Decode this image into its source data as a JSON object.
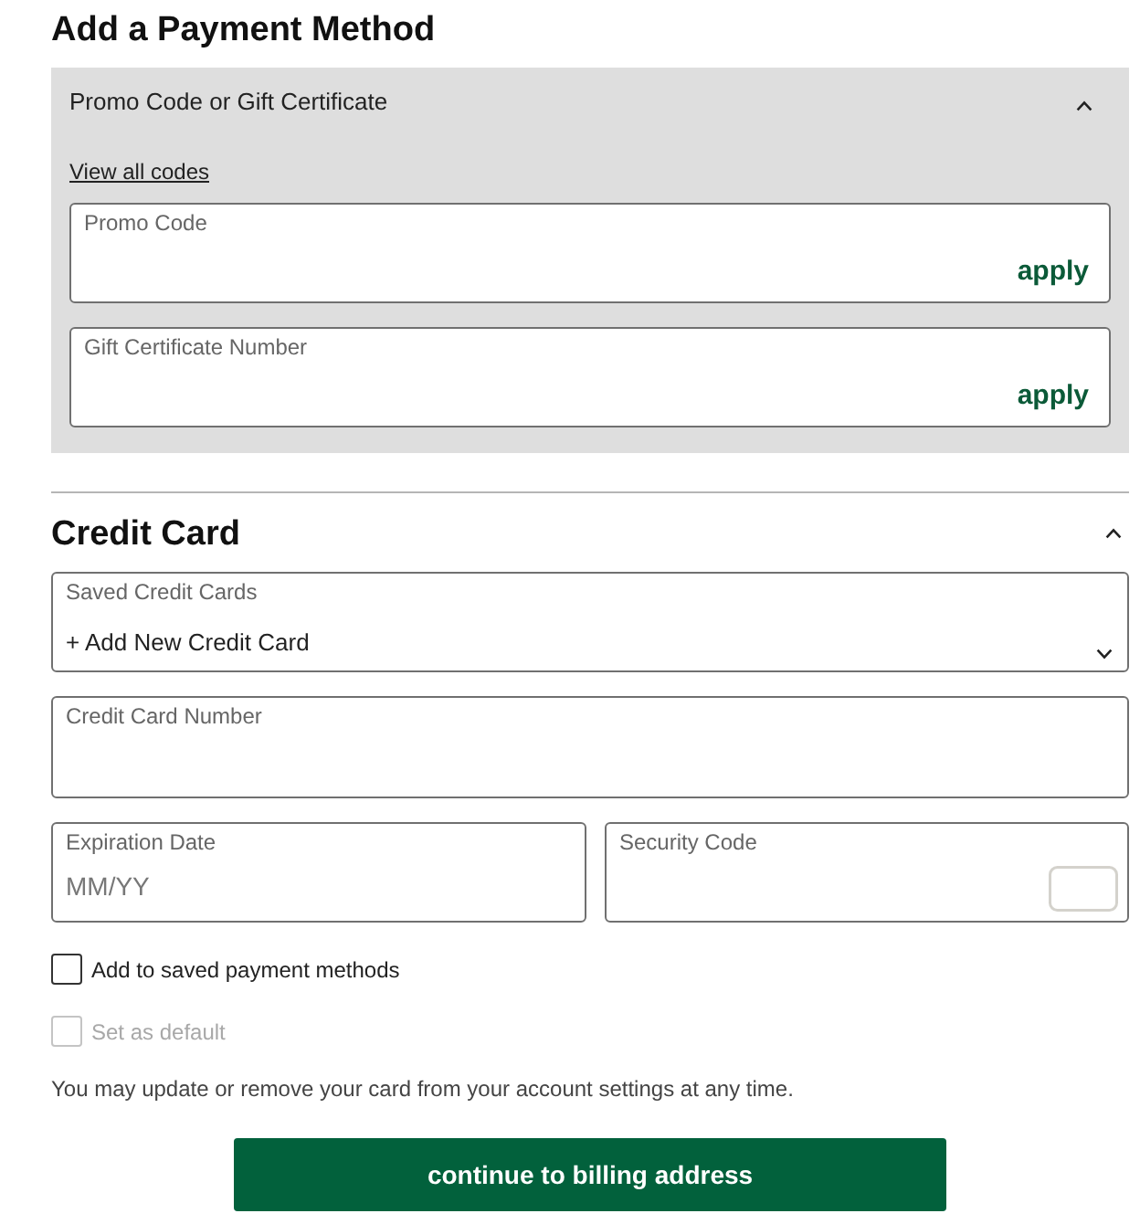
{
  "heading": "Add a Payment Method",
  "promo_panel": {
    "title": "Promo Code or Gift Certificate",
    "expanded": true,
    "link": "View all codes",
    "fields": [
      {
        "label": "Promo Code",
        "action": "apply"
      },
      {
        "label": "Gift Certificate Number",
        "action": "apply"
      }
    ]
  },
  "credit_card": {
    "title": "Credit Card",
    "expanded": true,
    "saved_cards": {
      "label": "Saved Credit Cards",
      "value": "+ Add New Credit Card"
    },
    "card_number": {
      "label": "Credit Card Number"
    },
    "expiration": {
      "label": "Expiration Date",
      "placeholder": "MM/YY"
    },
    "security_code": {
      "label": "Security Code"
    }
  },
  "checkboxes": [
    {
      "label": "Add to saved payment methods",
      "checked": false,
      "disabled": false
    },
    {
      "label": "Set as default",
      "checked": false,
      "disabled": true
    }
  ],
  "note": "You may update or remove your card from your account settings at any time.",
  "button": "continue to billing address"
}
